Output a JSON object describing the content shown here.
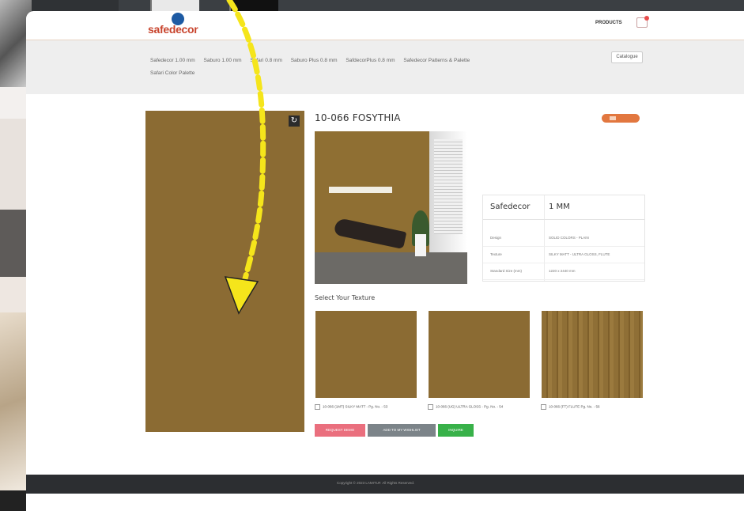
{
  "header": {
    "logo_text": "safedecor",
    "products_label": "PRODUCTS"
  },
  "nav": {
    "links": [
      "Safedecor 1.00 mm",
      "Saburo 1.00 mm",
      "Safari 0.8 mm",
      "Saburo Plus 0.8 mm",
      "SafdecorPlus 0.8 mm",
      "Safedecor Patterns & Palette",
      "Safari Color Palette"
    ],
    "catalogue_label": "Catalogue"
  },
  "product": {
    "title": "10-066 FOSYTHIA",
    "spec": {
      "brand": "Safedecor",
      "size": "1 MM",
      "rows": [
        {
          "key": "Design",
          "value": "SOLID COLORS - PLAIN"
        },
        {
          "key": "Texture",
          "value": "SILKY MATT - ULTRA GLOSS, FLUTE"
        },
        {
          "key": "Standard Size (mm)",
          "value": "1220 x 2440 mm"
        }
      ]
    },
    "select_label": "Select Your Texture",
    "textures": [
      {
        "label": "10-066 (1MT) SILKY MATT - Pg. No. - 53"
      },
      {
        "label": "10-066 (UG) ULTRA GLOSS - Pg. No. - 54"
      },
      {
        "label": "10-066 (FT) FLUTE Pg. No. - 56"
      }
    ]
  },
  "buttons": {
    "request": "REQUEST DEMO",
    "wishlist": "ADD TO MY WISHLIST",
    "inquiry": "INQUIRE"
  },
  "footer": {
    "copyright": "Copyright © 2023 LAMITUF. All Rights Reserved."
  },
  "colors": {
    "swatch": "#8b6b33",
    "accent_orange": "#e2773f",
    "brand_red": "#c8442d",
    "arrow": "#f5e51b"
  }
}
